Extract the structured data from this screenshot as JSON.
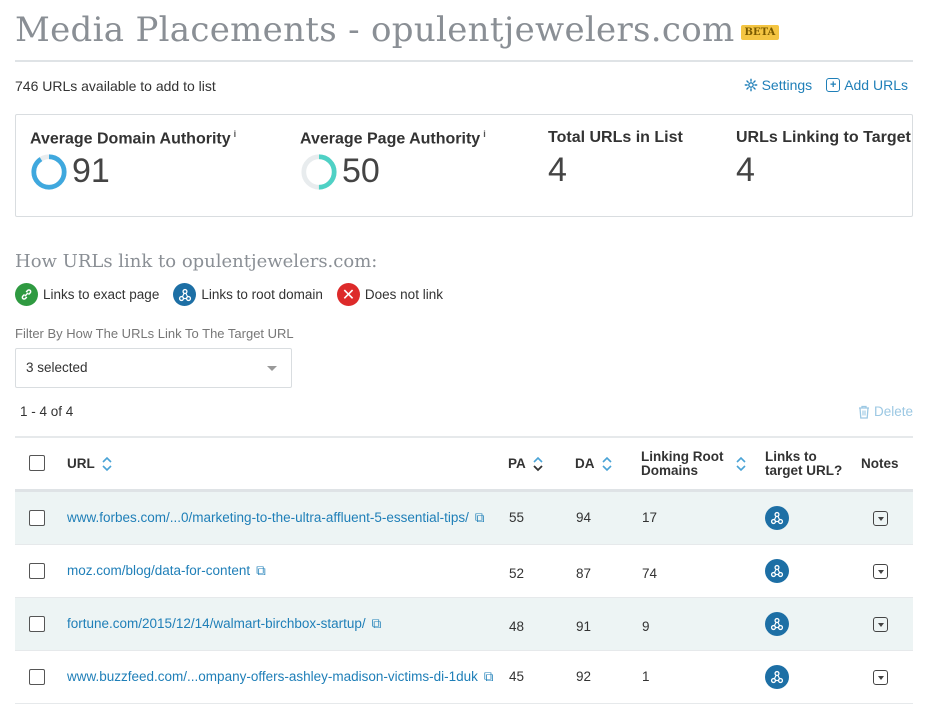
{
  "header": {
    "title": "Media Placements - opulentjewelers.com",
    "badge": "BETA"
  },
  "toolbar": {
    "urls_available": "746 URLs available to add to list",
    "settings_label": "Settings",
    "add_urls_label": "Add URLs"
  },
  "stats": [
    {
      "label": "Average Domain Authority",
      "info": "i",
      "value": "91",
      "ring_fraction": 0.91,
      "ring_color": "#3fa8de"
    },
    {
      "label": "Average Page Authority",
      "info": "i",
      "value": "50",
      "ring_fraction": 0.5,
      "ring_color": "#4fd1c5"
    },
    {
      "label": "Total URLs in List",
      "value": "4"
    },
    {
      "label": "URLs Linking to Target",
      "value": "4"
    }
  ],
  "legend": {
    "heading": "How URLs link to opulentjewelers.com:",
    "items": [
      {
        "label": "Links to exact page",
        "icon": "link-icon",
        "color": "#2f9a41"
      },
      {
        "label": "Links to root domain",
        "icon": "network-icon",
        "color": "#1d6fa5"
      },
      {
        "label": "Does not link",
        "icon": "x-icon",
        "color": "#dd2a2a"
      }
    ]
  },
  "filter": {
    "label": "Filter By How The URLs Link To The Target URL",
    "selected": "3 selected"
  },
  "pagination": {
    "range": "1 - 4 of 4"
  },
  "actions": {
    "delete_label": "Delete"
  },
  "table": {
    "columns": {
      "url": "URL",
      "pa": "PA",
      "da": "DA",
      "lrd": "Linking Root Domains",
      "links": "Links to target URL?",
      "notes": "Notes"
    },
    "rows": [
      {
        "url": "www.forbes.com/...0/marketing-to-the-ultra-affluent-5-essential-tips/",
        "pa": "55",
        "da": "94",
        "lrd": "17",
        "link_type": "root-domain"
      },
      {
        "url": "moz.com/blog/data-for-content",
        "pa": "52",
        "da": "87",
        "lrd": "74",
        "link_type": "root-domain"
      },
      {
        "url": "fortune.com/2015/12/14/walmart-birchbox-startup/",
        "pa": "48",
        "da": "91",
        "lrd": "9",
        "link_type": "root-domain"
      },
      {
        "url": "www.buzzfeed.com/...ompany-offers-ashley-madison-victims-di-1duk",
        "pa": "45",
        "da": "92",
        "lrd": "1",
        "link_type": "root-domain"
      }
    ]
  },
  "colors": {
    "link": "#1f7fb8",
    "title_gray": "#8a8f95",
    "row_alt": "#edf4f4"
  }
}
